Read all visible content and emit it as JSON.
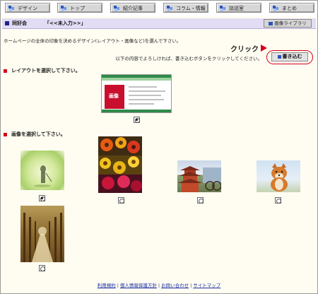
{
  "nav": {
    "items": [
      "デザイン",
      "トップ",
      "紹介記事",
      "コラム・情報",
      "談話室",
      "まとめ"
    ]
  },
  "titlebar": {
    "label": "同好会",
    "value": "「<<未入力>>」",
    "library_button": "画像ライブラリ"
  },
  "intro": "ホームページの全体の印象を決めるデザイン(レイアウト・画像など)を選んで下さい。",
  "callout": {
    "click_label": "クリック",
    "note": "以下の内容でよろしければ、書き込むボタンをクリックしてください。",
    "write_button": "書き込む"
  },
  "layout_section": {
    "heading": "レイアウトを選択して下さい。",
    "thumbnail_caption": "画像"
  },
  "image_section": {
    "heading": "画像を選択して下さい。",
    "images": [
      {
        "name": "golf-photo",
        "selected": true
      },
      {
        "name": "flowers-photo",
        "selected": false
      },
      {
        "name": "pagoda-photo",
        "selected": false
      },
      {
        "name": "shiba-dog-photo",
        "selected": false
      },
      {
        "name": "tree-avenue-photo",
        "selected": false
      }
    ]
  },
  "footer": {
    "links": [
      "利用規約",
      "個人情報保護方針",
      "お問い合わせ",
      "サイトマップ"
    ],
    "separator": "|"
  },
  "colors": {
    "accent_red": "#d4001a",
    "title_bg": "#e2dcf5",
    "page_bg": "#fffdf2",
    "link": "#1c2fa5"
  }
}
